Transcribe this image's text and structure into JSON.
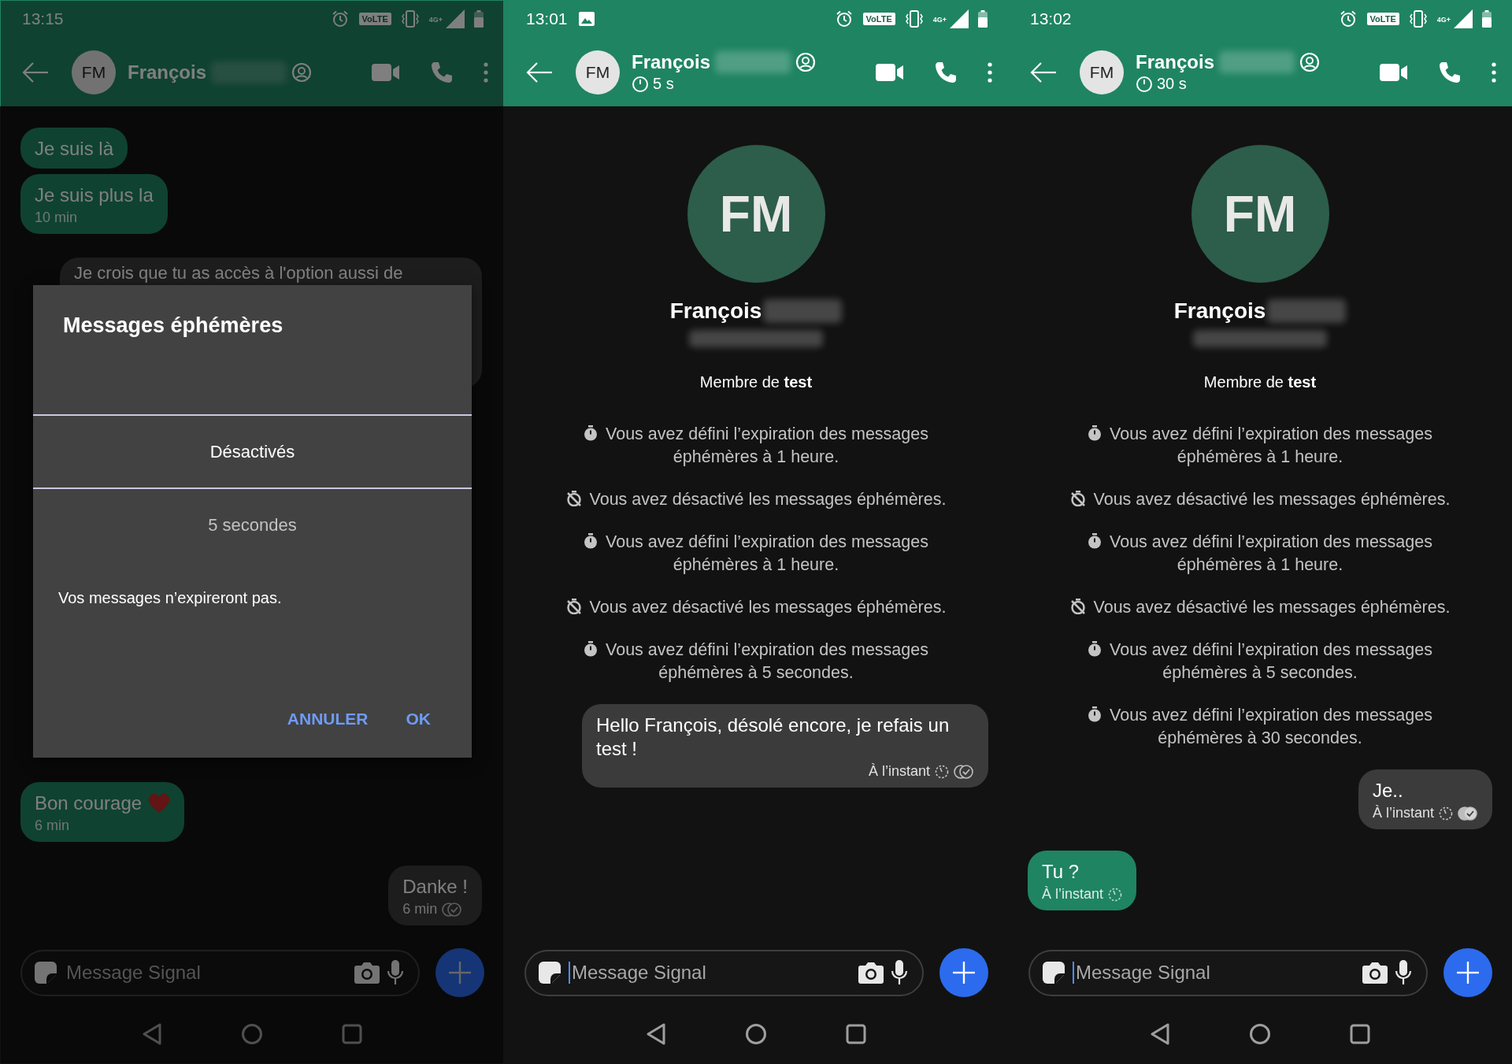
{
  "screens": [
    {
      "dimmed": true,
      "status_bar": {
        "time": "13:15",
        "volte_badge": "VoLTE",
        "network_type": "4G+"
      },
      "header": {
        "avatar_initials": "FM",
        "name": "François",
        "surname_hidden": true
      },
      "messages": [
        {
          "kind": "incoming",
          "text": "Je suis là"
        },
        {
          "kind": "incoming",
          "text": "Je suis plus la",
          "time": "10 min"
        },
        {
          "kind": "outgoing_cut",
          "text": "Je crois que tu as accès à l'option aussi de"
        }
      ],
      "recent_messages": [
        {
          "kind": "incoming",
          "text": "Bon courage",
          "heart": true,
          "time": "6 min"
        },
        {
          "kind": "outgoing",
          "text": "Danke !",
          "time": "6 min",
          "read": false
        }
      ],
      "dialog": {
        "title": "Messages éphémères",
        "options": [
          {
            "label": "Désactivés",
            "selected": true
          },
          {
            "label": "5 secondes",
            "selected": false
          }
        ],
        "description": "Vos messages n’expireront pas.",
        "buttons": [
          "ANNULER",
          "OK"
        ]
      },
      "composer": {
        "placeholder": "Message Signal"
      }
    },
    {
      "status_bar": {
        "time": "13:01",
        "image_notification": true,
        "volte_badge": "VoLTE",
        "network_type": "4G+"
      },
      "header": {
        "avatar_initials": "FM",
        "name": "François",
        "surname_hidden": true,
        "timer": "5 s"
      },
      "profile": {
        "avatar_initials": "FM",
        "name": "François",
        "surname_hidden": true,
        "membership": "Membre de **test**"
      },
      "events": [
        {
          "kind": "set",
          "text": "Vous avez défini l’expiration des messages éphémères à 1 heure."
        },
        {
          "kind": "off",
          "text": "Vous avez désactivé les messages éphémères."
        },
        {
          "kind": "set",
          "text": "Vous avez défini l’expiration des messages éphémères à 1 heure."
        },
        {
          "kind": "off",
          "text": "Vous avez désactivé les messages éphémères."
        },
        {
          "kind": "set",
          "text": "Vous avez défini l’expiration des messages éphémères à 5 secondes."
        }
      ],
      "messages": [
        {
          "kind": "outgoing",
          "text": "Hello François, désolé encore, je refais un test !",
          "time": "À l’instant",
          "expiring": true,
          "read": false
        }
      ],
      "composer": {
        "placeholder": "Message Signal",
        "cursor": true
      }
    },
    {
      "status_bar": {
        "time": "13:02",
        "volte_badge": "VoLTE",
        "network_type": "4G+"
      },
      "header": {
        "avatar_initials": "FM",
        "name": "François",
        "surname_hidden": true,
        "timer": "30 s"
      },
      "profile": {
        "avatar_initials": "FM",
        "name": "François",
        "surname_hidden": true,
        "membership": "Membre de **test**"
      },
      "events": [
        {
          "kind": "set",
          "text": "Vous avez défini l’expiration des messages éphémères à 1 heure."
        },
        {
          "kind": "off",
          "text": "Vous avez désactivé les messages éphémères."
        },
        {
          "kind": "set",
          "text": "Vous avez défini l’expiration des messages éphémères à 1 heure."
        },
        {
          "kind": "off",
          "text": "Vous avez désactivé les messages éphémères."
        },
        {
          "kind": "set",
          "text": "Vous avez défini l’expiration des messages éphémères à 5 secondes."
        },
        {
          "kind": "set",
          "text": "Vous avez défini l’expiration des messages éphémères à 30 secondes."
        }
      ],
      "messages": [
        {
          "kind": "outgoing",
          "text": "Je..",
          "time": "À l’instant",
          "expiring": true,
          "read": true
        },
        {
          "kind": "incoming",
          "text": "Tu ?",
          "time": "À l’instant",
          "expiring": true
        }
      ],
      "composer": {
        "placeholder": "Message Signal",
        "cursor": true
      }
    }
  ]
}
